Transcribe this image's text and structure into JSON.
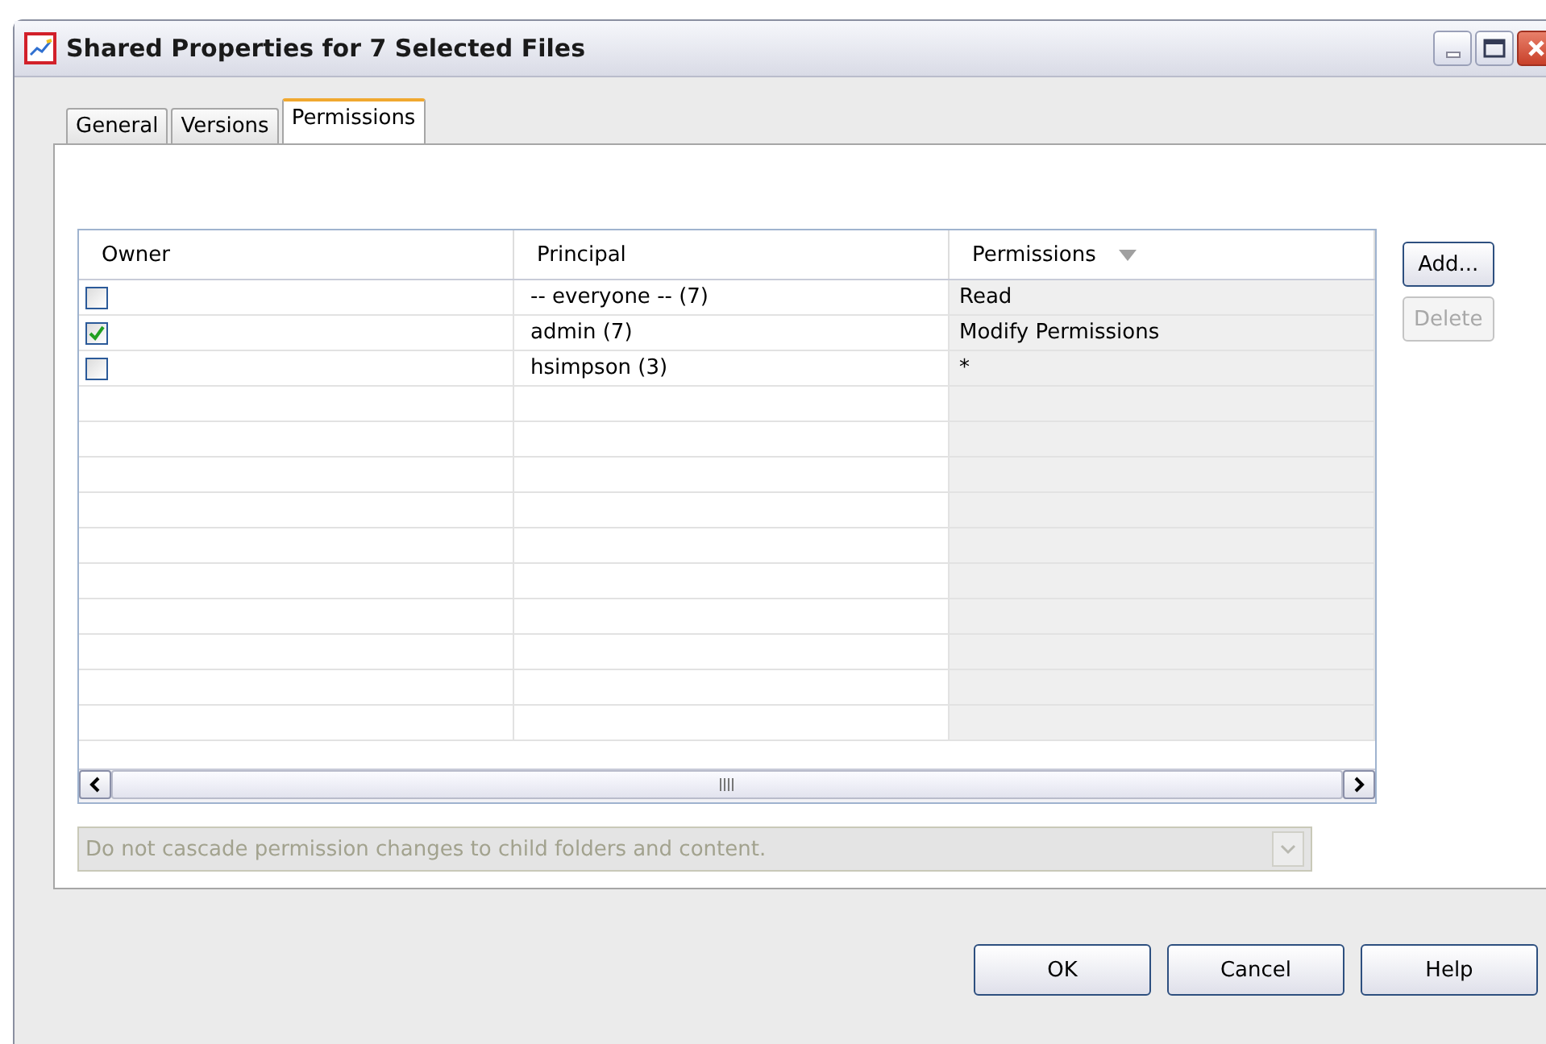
{
  "window": {
    "title": "Shared Properties for 7 Selected Files"
  },
  "tabs": [
    {
      "label": "General",
      "selected": false
    },
    {
      "label": "Versions",
      "selected": false
    },
    {
      "label": "Permissions",
      "selected": true
    }
  ],
  "table": {
    "columns": [
      {
        "label": "Owner",
        "sorted": false
      },
      {
        "label": "Principal",
        "sorted": false
      },
      {
        "label": "Permissions",
        "sorted": true
      }
    ],
    "rows": [
      {
        "owner": false,
        "principal": "-- everyone -- (7)",
        "permissions": "Read"
      },
      {
        "owner": true,
        "principal": "admin (7)",
        "permissions": "Modify Permissions"
      },
      {
        "owner": false,
        "principal": "hsimpson (3)",
        "permissions": "*"
      }
    ]
  },
  "side_buttons": [
    {
      "label": "Add...",
      "disabled": false
    },
    {
      "label": "Delete",
      "disabled": true
    }
  ],
  "cascade_dropdown": {
    "value": "Do not cascade permission changes to child folders and content.",
    "disabled": true
  },
  "buttons": [
    "OK",
    "Cancel",
    "Help"
  ]
}
